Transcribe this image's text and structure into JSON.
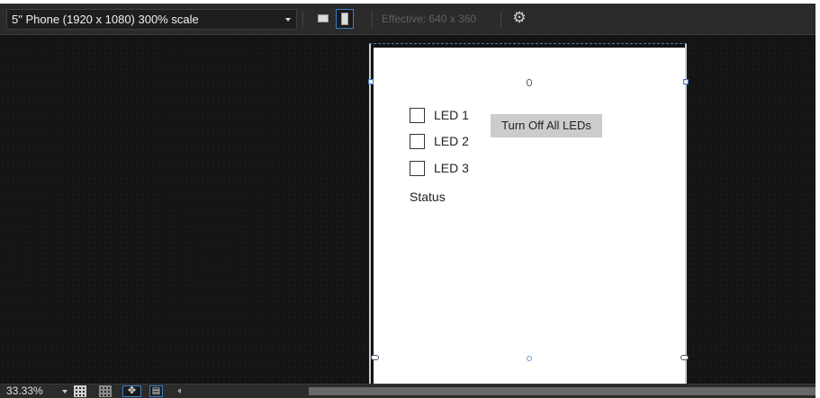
{
  "toolbar": {
    "device_label": "5\" Phone (1920 x 1080) 300% scale",
    "effective_label": "Effective: 640 x 360",
    "icons": {
      "dropdown": "chevron-down-icon",
      "landscape": "landscape-orientation-icon",
      "portrait": "portrait-orientation-icon",
      "settings": "gear-icon"
    },
    "selected_orientation": "portrait"
  },
  "design_surface": {
    "checkboxes": [
      {
        "label": "LED 1",
        "checked": false
      },
      {
        "label": "LED 2",
        "checked": false
      },
      {
        "label": "LED 3",
        "checked": false
      }
    ],
    "status_text": "Status",
    "button_label": "Turn Off All LEDs"
  },
  "bottombar": {
    "zoom_label": "33.33%",
    "icons": [
      "grid-icon",
      "grid-icon",
      "snap-to-gridlines-icon",
      "snap-to-snaplines-icon",
      "scroll-left-icon"
    ]
  },
  "colors": {
    "toolbar_bg": "#2b2b2b",
    "canvas_bg": "#141414",
    "selection_accent": "#3a7fc8",
    "button_bg": "#cccccc"
  }
}
